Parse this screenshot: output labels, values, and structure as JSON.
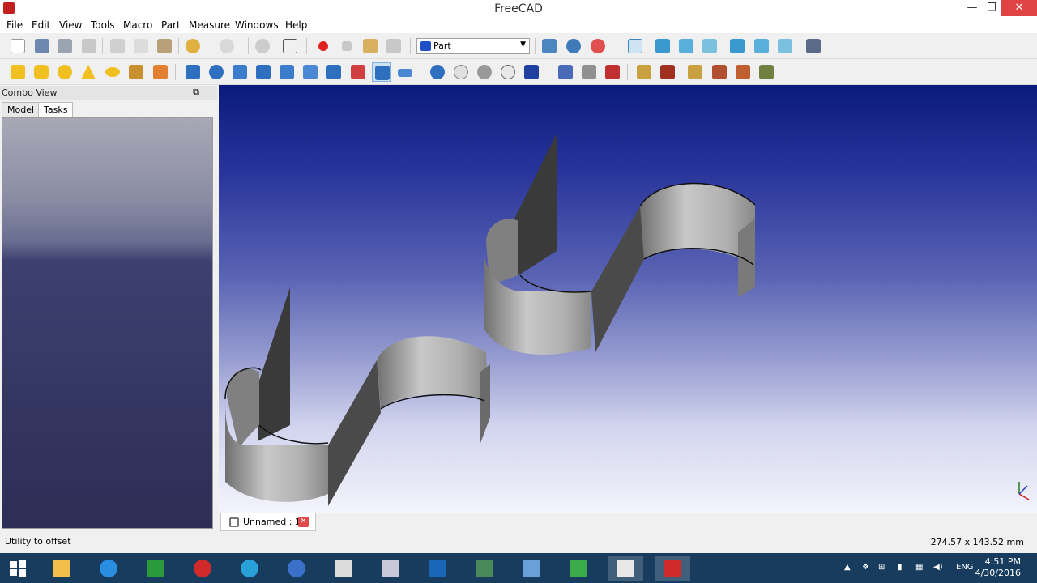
{
  "window": {
    "title": "FreeCAD",
    "minimize": "—",
    "restore": "❐",
    "close": "✕"
  },
  "menu": [
    "File",
    "Edit",
    "View",
    "Tools",
    "Macro",
    "Part",
    "Measure",
    "Windows",
    "Help"
  ],
  "workbench": {
    "selected": "Part"
  },
  "combo_view": {
    "title": "Combo View",
    "tabs": [
      "Model",
      "Tasks"
    ],
    "active_tab": "Tasks"
  },
  "document_tab": {
    "label": "Unnamed : 1*",
    "close": "✕"
  },
  "status": {
    "message": "Utility to offset",
    "dimensions": "274.57 x 143.52 mm"
  },
  "taskbar": {
    "tray_lang": "ENG",
    "time": "4:51 PM",
    "date": "4/30/2016"
  },
  "colors": {
    "accent_close": "#e04343",
    "taskbar": "#173c5e",
    "viewport_top": "#0b1a7d",
    "viewport_bottom": "#f4f4fc"
  }
}
